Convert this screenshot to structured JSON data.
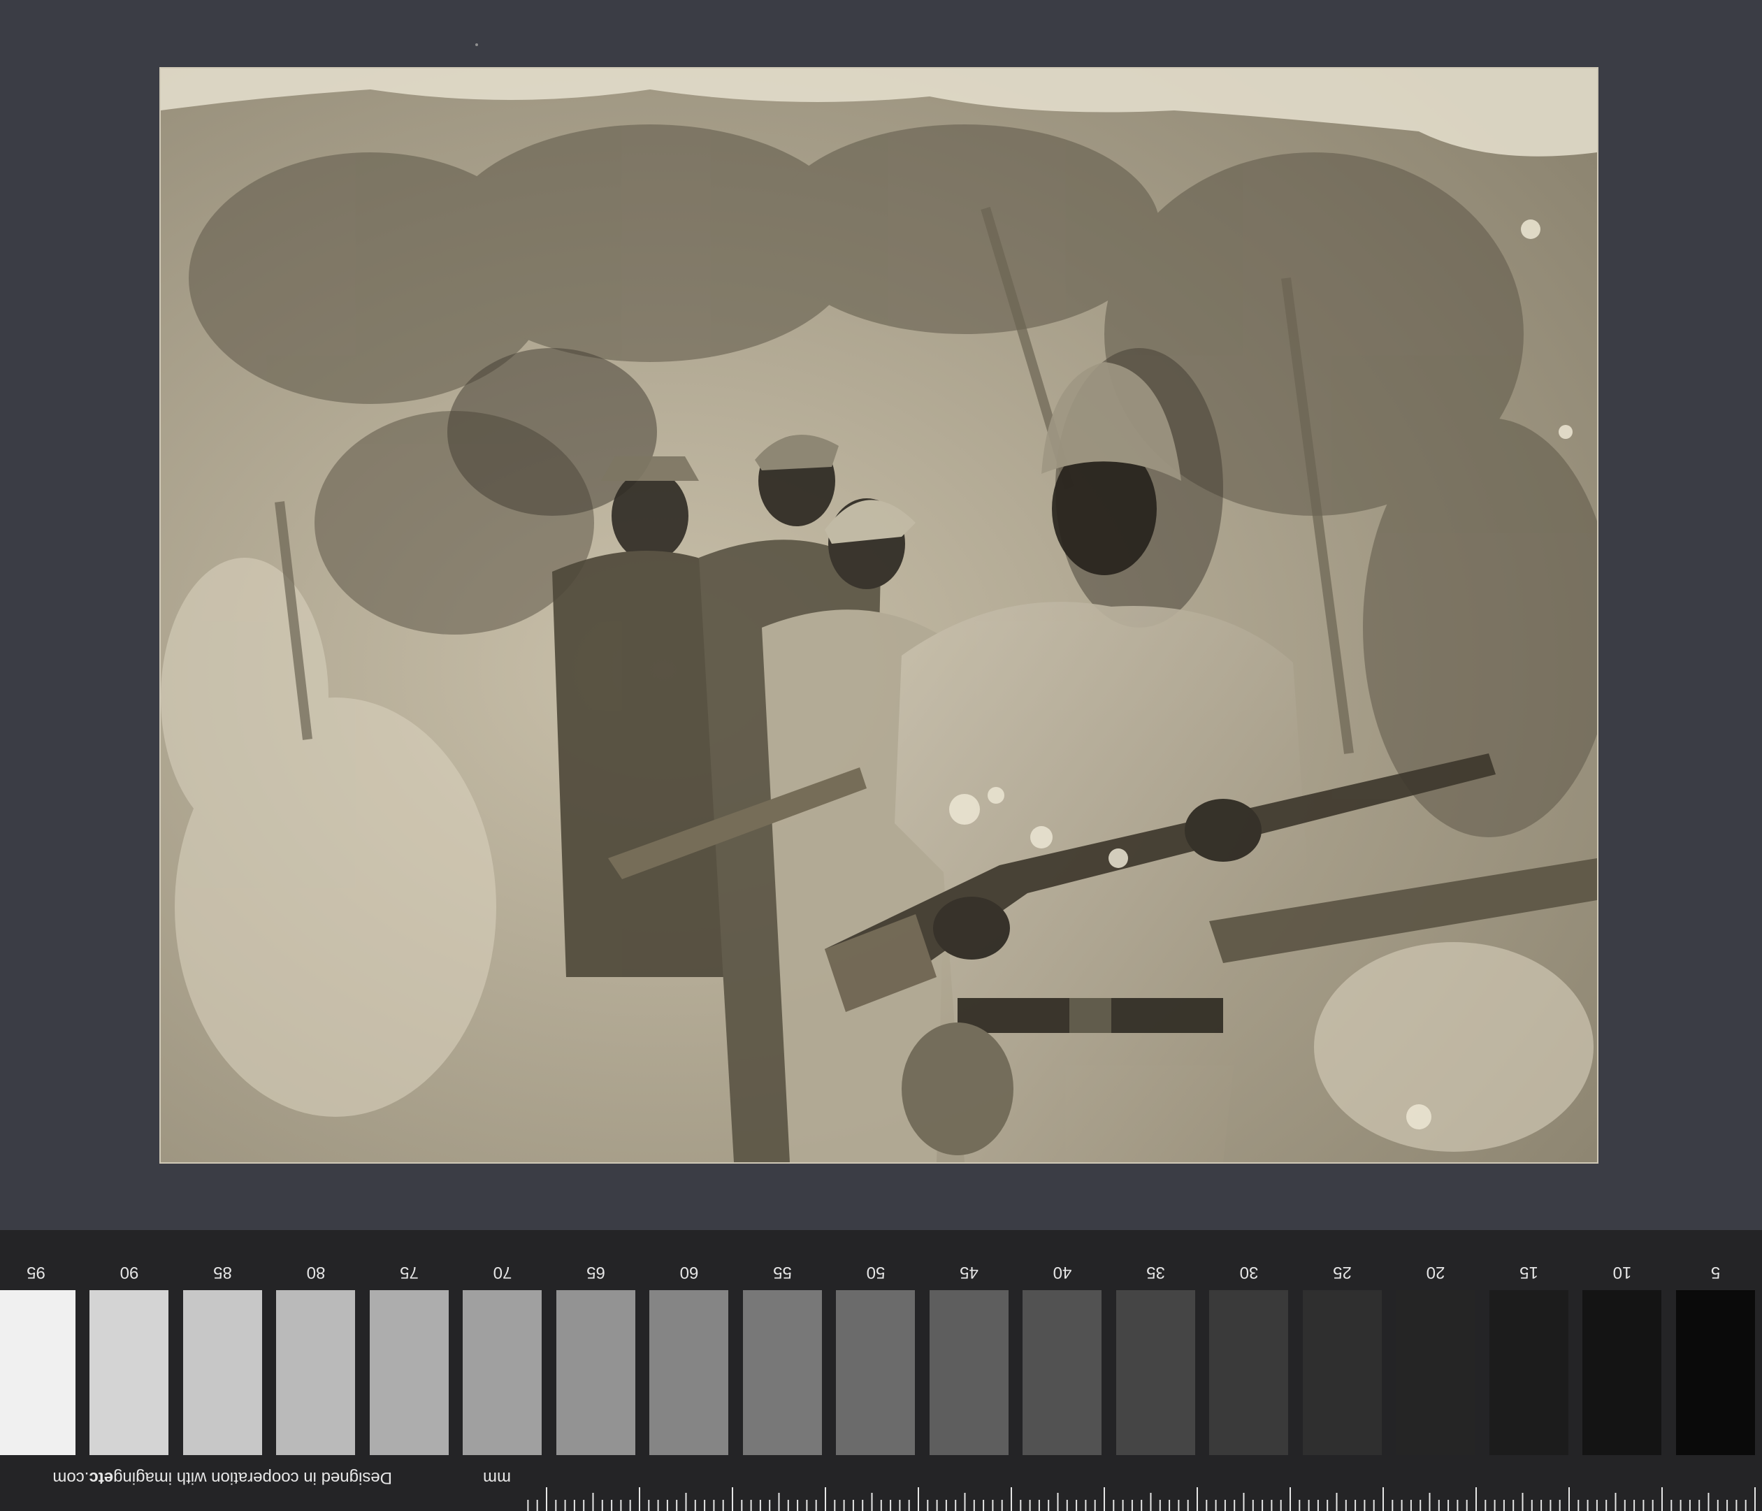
{
  "photo": {
    "subject": "photograph-print",
    "icon": "photograph-icon"
  },
  "target": {
    "ruler_unit": "mm",
    "credit_prefix": "Designed in cooperation with imaging",
    "credit_brand": "etc",
    "credit_suffix": ".com",
    "patch_labels": [
      "5",
      "10",
      "15",
      "20",
      "25",
      "30",
      "35",
      "40",
      "45",
      "50",
      "55",
      "60",
      "65",
      "70",
      "75",
      "80",
      "85",
      "90",
      "95"
    ],
    "patch_colors": [
      "#0a0a0a",
      "#141414",
      "#1c1c1c",
      "#252525",
      "#2f2f2f",
      "#3a3a3a",
      "#454545",
      "#525252",
      "#5e5e5e",
      "#6b6b6b",
      "#787878",
      "#858585",
      "#939393",
      "#a0a0a0",
      "#adadad",
      "#bababa",
      "#c7c7c7",
      "#d4d4d4",
      "#f0f0f0"
    ]
  }
}
